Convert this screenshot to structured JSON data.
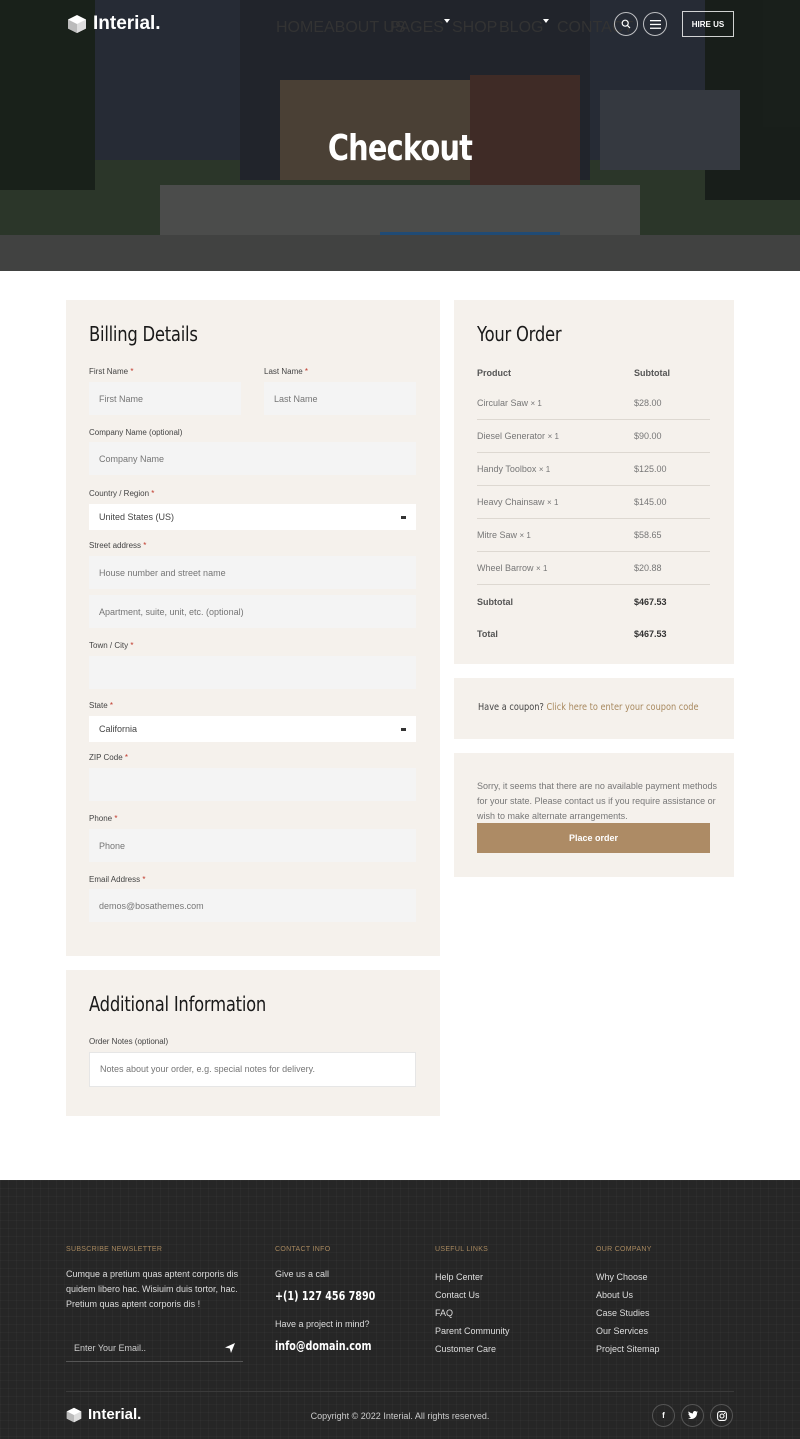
{
  "brand": {
    "name": "Interial."
  },
  "nav": {
    "items": [
      {
        "label": "HOME"
      },
      {
        "label": "ABOUT US"
      },
      {
        "label": "PAGES"
      },
      {
        "label": "SHOP"
      },
      {
        "label": "BLOG"
      },
      {
        "label": "CONTACT"
      }
    ],
    "hire_label": "HIRE US",
    "icons": [
      "search-icon",
      "menu-icon"
    ]
  },
  "hero": {
    "title": "Checkout"
  },
  "billing": {
    "title": "Billing Details",
    "first_name_label": "First Name",
    "first_name_placeholder": "First Name",
    "last_name_label": "Last Name",
    "last_name_placeholder": "Last Name",
    "company_label": "Company Name (optional)",
    "company_placeholder": "Company Name",
    "country_label": "Country / Region",
    "country_value": "United States (US)",
    "street_label": "Street address",
    "street1_placeholder": "House number and street name",
    "street2_placeholder": "Apartment, suite, unit, etc. (optional)",
    "town_label": "Town / City",
    "state_label": "State",
    "state_value": "California",
    "zip_label": "ZIP Code",
    "phone_label": "Phone",
    "phone_placeholder": "Phone",
    "email_label": "Email Address",
    "email_value": "demos@bosathemes.com",
    "required_mark": "*"
  },
  "additional": {
    "title": "Additional Information",
    "notes_label": "Order Notes (optional)",
    "notes_placeholder": "Notes about your order, e.g. special notes for delivery."
  },
  "order": {
    "title": "Your Order",
    "col_product": "Product",
    "col_subtotal": "Subtotal",
    "items": [
      {
        "name": "Circular Saw",
        "qty": "× 1",
        "price": "$28.00"
      },
      {
        "name": "Diesel Generator",
        "qty": "× 1",
        "price": "$90.00"
      },
      {
        "name": "Handy Toolbox",
        "qty": "× 1",
        "price": "$125.00"
      },
      {
        "name": "Heavy Chainsaw",
        "qty": "× 1",
        "price": "$145.00"
      },
      {
        "name": "Mitre Saw",
        "qty": "× 1",
        "price": "$58.65"
      },
      {
        "name": "Wheel Barrow",
        "qty": "× 1",
        "price": "$20.88"
      }
    ],
    "subtotal_label": "Subtotal",
    "subtotal_value": "$467.53",
    "total_label": "Total",
    "total_value": "$467.53"
  },
  "coupon": {
    "prompt": "Have a coupon?",
    "link": "Click here to enter your coupon code"
  },
  "payment": {
    "message": "Sorry, it seems that there are no available payment methods for your state. Please contact us if you require assistance or wish to make alternate arrangements.",
    "button": "Place order"
  },
  "footer": {
    "newsletter_title": "SUBSCRIBE NEWSLETTER",
    "newsletter_text": "Cumque a pretium quas aptent corporis dis quidem libero hac. Wisiuim duis tortor, hac. Pretium quas aptent corporis dis !",
    "newsletter_placeholder": "Enter Your Email..",
    "contact_title": "CONTACT INFO",
    "call_label": "Give us a call",
    "phone": "+(1) 127 456 7890",
    "project_label": "Have a project in mind?",
    "email": "info@domain.com",
    "useful_title": "USEFUL LINKS",
    "useful_links": [
      "Help Center",
      "Contact Us",
      "FAQ",
      "Parent Community",
      "Customer Care"
    ],
    "company_title": "OUR COMPANY",
    "company_links": [
      "Why Choose",
      "About Us",
      "Case Studies",
      "Our Services",
      "Project Sitemap"
    ],
    "copyright": "Copyright © 2022 Interial. All rights reserved.",
    "social": [
      {
        "icon": "facebook-icon",
        "glyph": "f"
      },
      {
        "icon": "twitter-icon",
        "glyph": "t"
      },
      {
        "icon": "instagram-icon",
        "glyph": "◎"
      }
    ]
  },
  "colors": {
    "accent": "#ad8b65",
    "panel": "#f5f1ec",
    "footer": "#262626"
  }
}
